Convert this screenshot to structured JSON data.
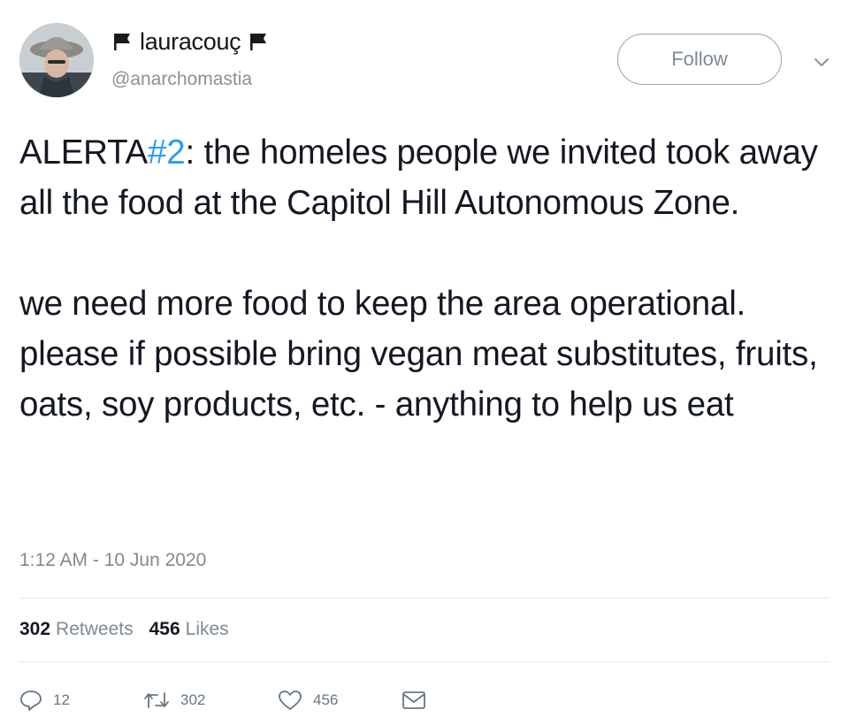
{
  "user": {
    "display_name": "lauracouç",
    "handle": "@anarchomastia",
    "flag_icon": "black-flag-icon"
  },
  "header": {
    "follow_label": "Follow",
    "menu_icon": "chevron-down-icon"
  },
  "tweet": {
    "p1_prefix": "ALERTA",
    "p1_hashtag": "#2",
    "p1_rest": ": the homeles people we invited took away all the food at the Capitol Hill Autonomous Zone.",
    "p2": "we need more food to keep the area operational. please if possible bring vegan meat substitutes, fruits, oats, soy products, etc. - anything to help us eat",
    "timestamp": "1:12 AM - 10 Jun 2020"
  },
  "stats": {
    "retweets_count": "302",
    "retweets_label": "Retweets",
    "likes_count": "456",
    "likes_label": "Likes"
  },
  "actions": {
    "reply_count": "12",
    "retweet_count": "302",
    "like_count": "456"
  },
  "colors": {
    "hashtag": "#2a9df4",
    "muted": "#7f8a96",
    "text": "#141823"
  }
}
